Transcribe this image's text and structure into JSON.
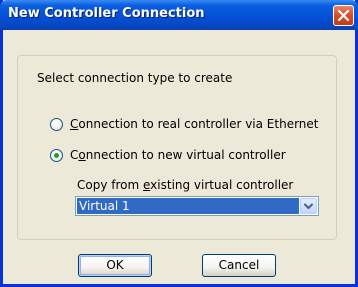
{
  "window": {
    "title": "New Controller Connection"
  },
  "dialog": {
    "prompt": "Select connection type to create",
    "options": [
      {
        "key": "C",
        "rest": "onnection to real controller via Ethernet",
        "checked": false
      },
      {
        "key": "o",
        "first": "C",
        "rest": "nnection to new virtual controller",
        "checked": true
      }
    ],
    "copy_label_pre": "Copy from ",
    "copy_label_key": "e",
    "copy_label_post": "xisting virtual controller",
    "copy_select_value": "Virtual 1"
  },
  "buttons": {
    "ok_label": "OK",
    "cancel_label": "Cancel"
  },
  "icons": {
    "close": "close-icon",
    "dropdown": "chevron-down-icon"
  },
  "colors": {
    "title_bar": "#0550d6",
    "close_button": "#d8502a",
    "selection": "#316ac5",
    "radio_dot": "#21a121"
  }
}
